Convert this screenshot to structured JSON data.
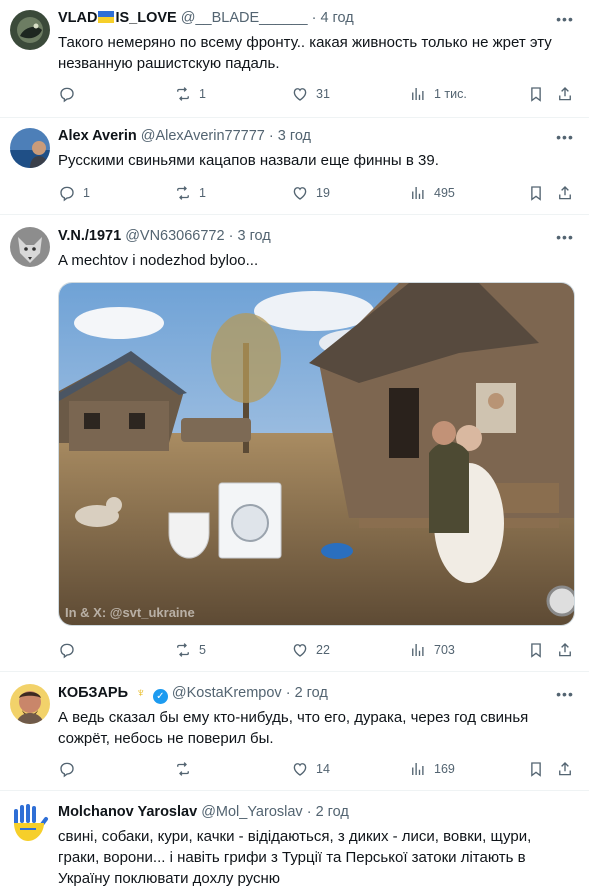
{
  "tweets": [
    {
      "name_part1": "VLAD",
      "name_part2": "IS_LOVE",
      "handle": "@__BLADE______",
      "time": "4 год",
      "text_line1": "Такого немеряно по всему  фронту.. какая живность только не жрет эту",
      "text_line2": "незванную рашистскую падаль.",
      "replies": "",
      "reposts": "1",
      "likes": "31",
      "views": "1 тис."
    },
    {
      "name": "Alex Averin",
      "handle": "@AlexAverin77777",
      "time": "3 год",
      "text_line1": "Русскими свиньями кацапов назвали еще финны в 39.",
      "replies": "1",
      "reposts": "1",
      "likes": "19",
      "views": "495"
    },
    {
      "name": "V.N./1971",
      "handle": "@VN63066772",
      "time": "3 год",
      "text_line1": "A mechtov i nodezhod byloo...",
      "replies": "",
      "reposts": "5",
      "likes": "22",
      "views": "703",
      "media_watermark": "In & X: @svt_ukraine"
    },
    {
      "name": "КОБЗАРЬ",
      "handle": "@KostaKrempov",
      "time": "2 год",
      "text_line1": "А ведь сказал бы ему кто-нибудь, что его, дурака, через год свинья",
      "text_line2": "сожрёт, небось не поверил бы.",
      "replies": "",
      "reposts": "",
      "likes": "14",
      "views": "169"
    },
    {
      "name": "Molchanov Yaroslav",
      "handle": "@Mol_Yaroslav",
      "time": "2 год",
      "text_line1": "свині, собаки, кури, качки - відідаються, з диких  - лиси, вовки, щури,",
      "text_line2": "граки, ворони... і навіть грифи з Турції та Перської затоки літають в",
      "text_line3": "Україну поклювати дохлу русню"
    }
  ],
  "separator": "·",
  "more_glyph": "•••",
  "colors": {
    "text": "#0f1419",
    "muted": "#536471",
    "divider": "#eff3f4",
    "verified": "#1d9bf0",
    "flag_blue": "#2f6fd6",
    "flag_yellow": "#f6cf2a"
  },
  "icons": [
    "reply-icon",
    "repost-icon",
    "like-icon",
    "views-icon",
    "bookmark-icon",
    "share-icon",
    "more-icon",
    "verified-badge-icon",
    "trident-icon",
    "ukraine-flag-icon"
  ]
}
